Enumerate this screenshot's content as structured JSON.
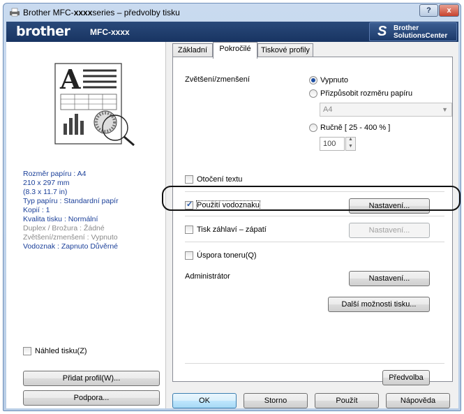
{
  "window": {
    "title_prefix": "Brother MFC-",
    "title_model": "xxxx",
    "title_suffix": "series – předvolby tisku",
    "help_glyph": "?",
    "close_glyph": "x"
  },
  "brand": {
    "logo": "brother",
    "model": "MFC-xxxx",
    "solutions_line1": "Brother",
    "solutions_line2": "SolutionsCenter"
  },
  "left": {
    "preview_letter": "A",
    "info": [
      {
        "text": "Rozměr papíru : A4",
        "style": "b"
      },
      {
        "text": "210 x 297 mm",
        "style": "b"
      },
      {
        "text": "(8.3 x 11.7 in)",
        "style": "b"
      },
      {
        "text": "Typ papíru : Standardní papír",
        "style": "b"
      },
      {
        "text": "Kopií : 1",
        "style": "b"
      },
      {
        "text": "Kvalita tisku : Normální",
        "style": "b"
      },
      {
        "text": "Duplex / Brožura : Žádné",
        "style": "g"
      },
      {
        "text": "Zvětšení/zmenšení : Vypnuto",
        "style": "g"
      },
      {
        "text": "Vodoznak : Zapnuto  Důvěrné",
        "style": "b"
      }
    ],
    "preview_checkbox": "Náhled tisku(Z)",
    "add_profile": "Přidat profil(W)...",
    "support": "Podpora..."
  },
  "tabs": [
    "Základní",
    "Pokročilé",
    "Tiskové profily"
  ],
  "advanced": {
    "scaling_label": "Zvětšení/zmenšení",
    "scaling_off": "Vypnuto",
    "scaling_fit": "Přizpůsobit rozměru papíru",
    "fit_select_value": "A4",
    "scaling_manual": "Ručně [ 25 - 400 % ]",
    "manual_value": "100",
    "mirror_text": "Otočení textu",
    "watermark": "Použití vodoznaku",
    "watermark_settings": "Nastavení...",
    "header_footer": "Tisk záhlaví – zápatí",
    "header_footer_settings": "Nastavení...",
    "toner_save": "Úspora toneru(Q)",
    "administrator": "Administrátor",
    "admin_settings": "Nastavení...",
    "more_options": "Další možnosti tisku...",
    "default": "Předvolba"
  },
  "footer": {
    "ok": "OK",
    "cancel": "Storno",
    "apply": "Použít",
    "help": "Nápověda"
  }
}
